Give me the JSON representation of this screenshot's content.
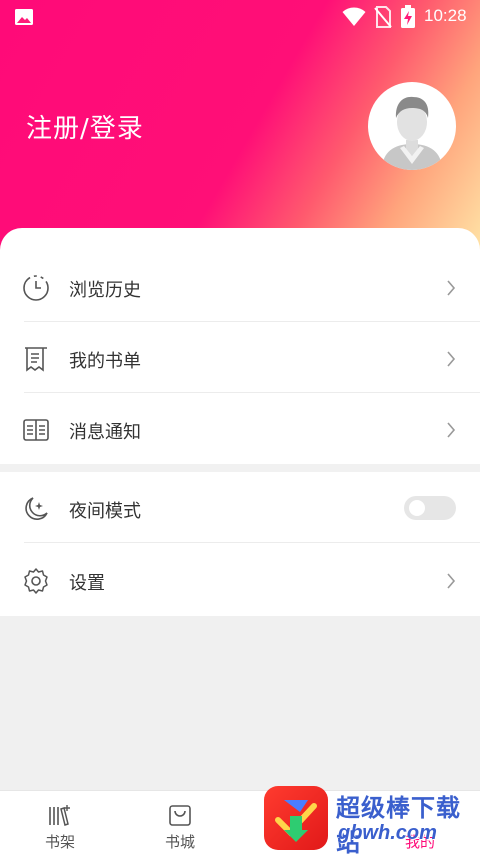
{
  "status_bar": {
    "time": "10:28"
  },
  "header": {
    "login_label": "注册/登录"
  },
  "menu": {
    "history": "浏览历史",
    "booklist": "我的书单",
    "messages": "消息通知",
    "night_mode": "夜间模式",
    "night_mode_on": false,
    "settings": "设置"
  },
  "tabs": [
    {
      "label": "书架",
      "icon": "bookshelf-icon"
    },
    {
      "label": "书城",
      "icon": "bookstore-bag-icon"
    },
    {
      "label": "",
      "icon": ""
    },
    {
      "label": "我的",
      "icon": "profile-icon"
    }
  ],
  "watermark": {
    "text": "超级棒下载站",
    "url": "gbwh.com"
  },
  "colors": {
    "brand_pink": "#ff0a78",
    "accent_gradient_end": "#ffe6a8"
  }
}
